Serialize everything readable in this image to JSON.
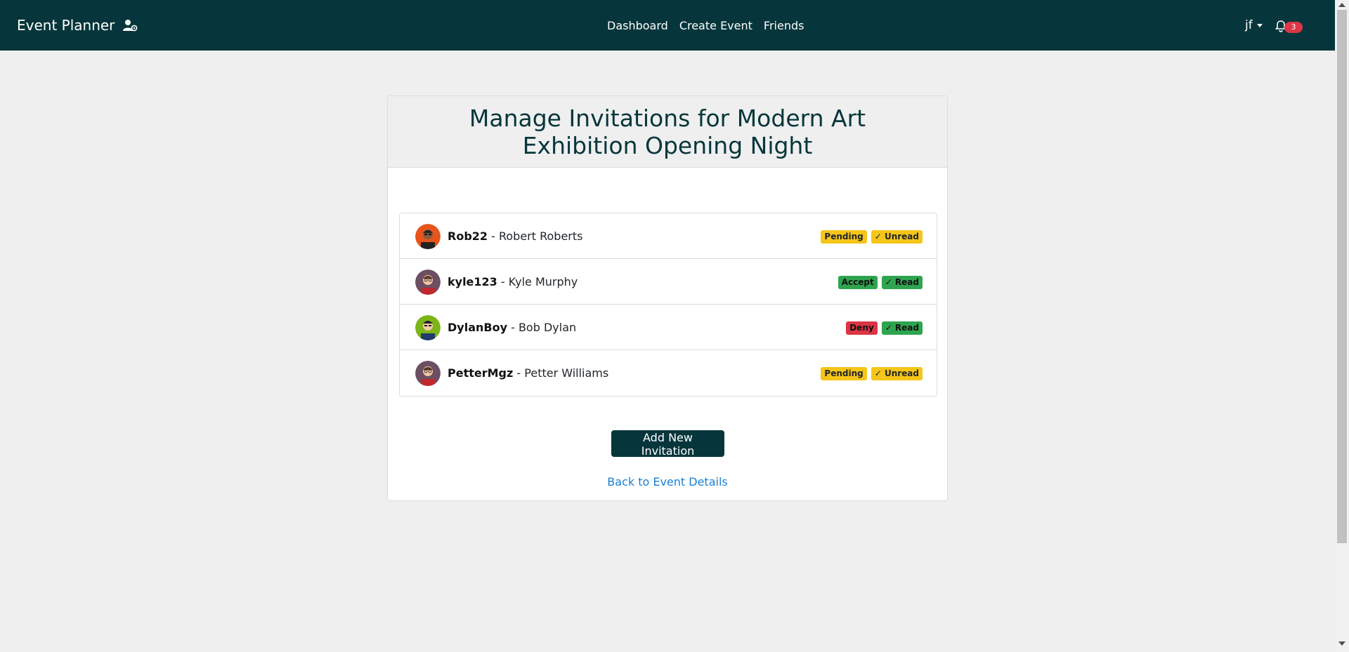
{
  "nav": {
    "brand": "Event Planner",
    "links": [
      "Dashboard",
      "Create Event",
      "Friends"
    ],
    "user": "jf",
    "notification_count": "3",
    "colors": {
      "background": "#06363b"
    }
  },
  "page": {
    "title": "Manage Invitations for Modern Art Exhibition Opening Night"
  },
  "invitations": [
    {
      "username": "Rob22",
      "full_name": "- Robert Roberts",
      "status": "Pending",
      "read": "✓ Unread",
      "status_color": "#f5c518",
      "read_color": "#f5c518",
      "avatar_bg": "#e8541c"
    },
    {
      "username": "kyle123",
      "full_name": "- Kyle Murphy",
      "status": "Accept",
      "read": "✓ Read",
      "status_color": "#2ea44f",
      "read_color": "#2ea44f",
      "avatar_bg": "#6c4f63"
    },
    {
      "username": "DylanBoy",
      "full_name": "- Bob Dylan",
      "status": "Deny",
      "read": "✓ Read",
      "status_color": "#dc3545",
      "read_color": "#2ea44f",
      "avatar_bg": "#7cb518"
    },
    {
      "username": "PetterMgz",
      "full_name": "- Petter Williams",
      "status": "Pending",
      "read": "✓ Unread",
      "status_color": "#f5c518",
      "read_color": "#f5c518",
      "avatar_bg": "#6c4f63"
    }
  ],
  "actions": {
    "add_label": "Add New Invitation",
    "back_label": "Back to Event Details"
  }
}
